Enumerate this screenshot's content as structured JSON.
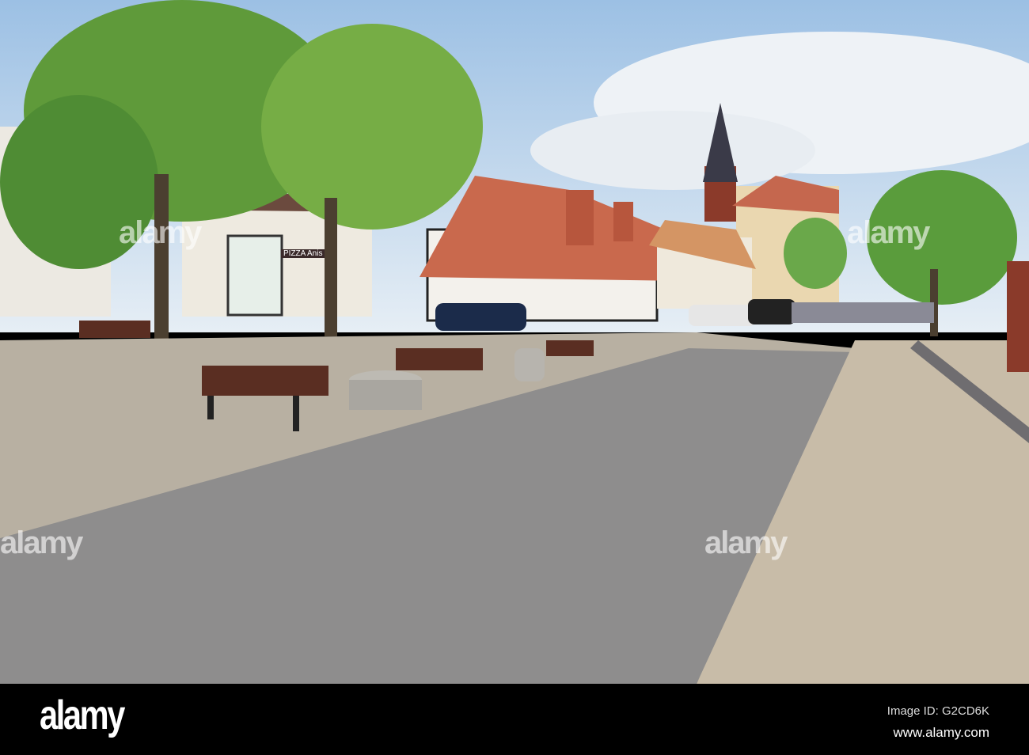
{
  "photo": {
    "subject": "town square street scene"
  },
  "shop_sign": "PIZZA Anis",
  "watermark": {
    "text": "alamy"
  },
  "footer": {
    "logo": "alamy",
    "image_id": "Image ID: G2CD6K",
    "url": "www.alamy.com"
  }
}
